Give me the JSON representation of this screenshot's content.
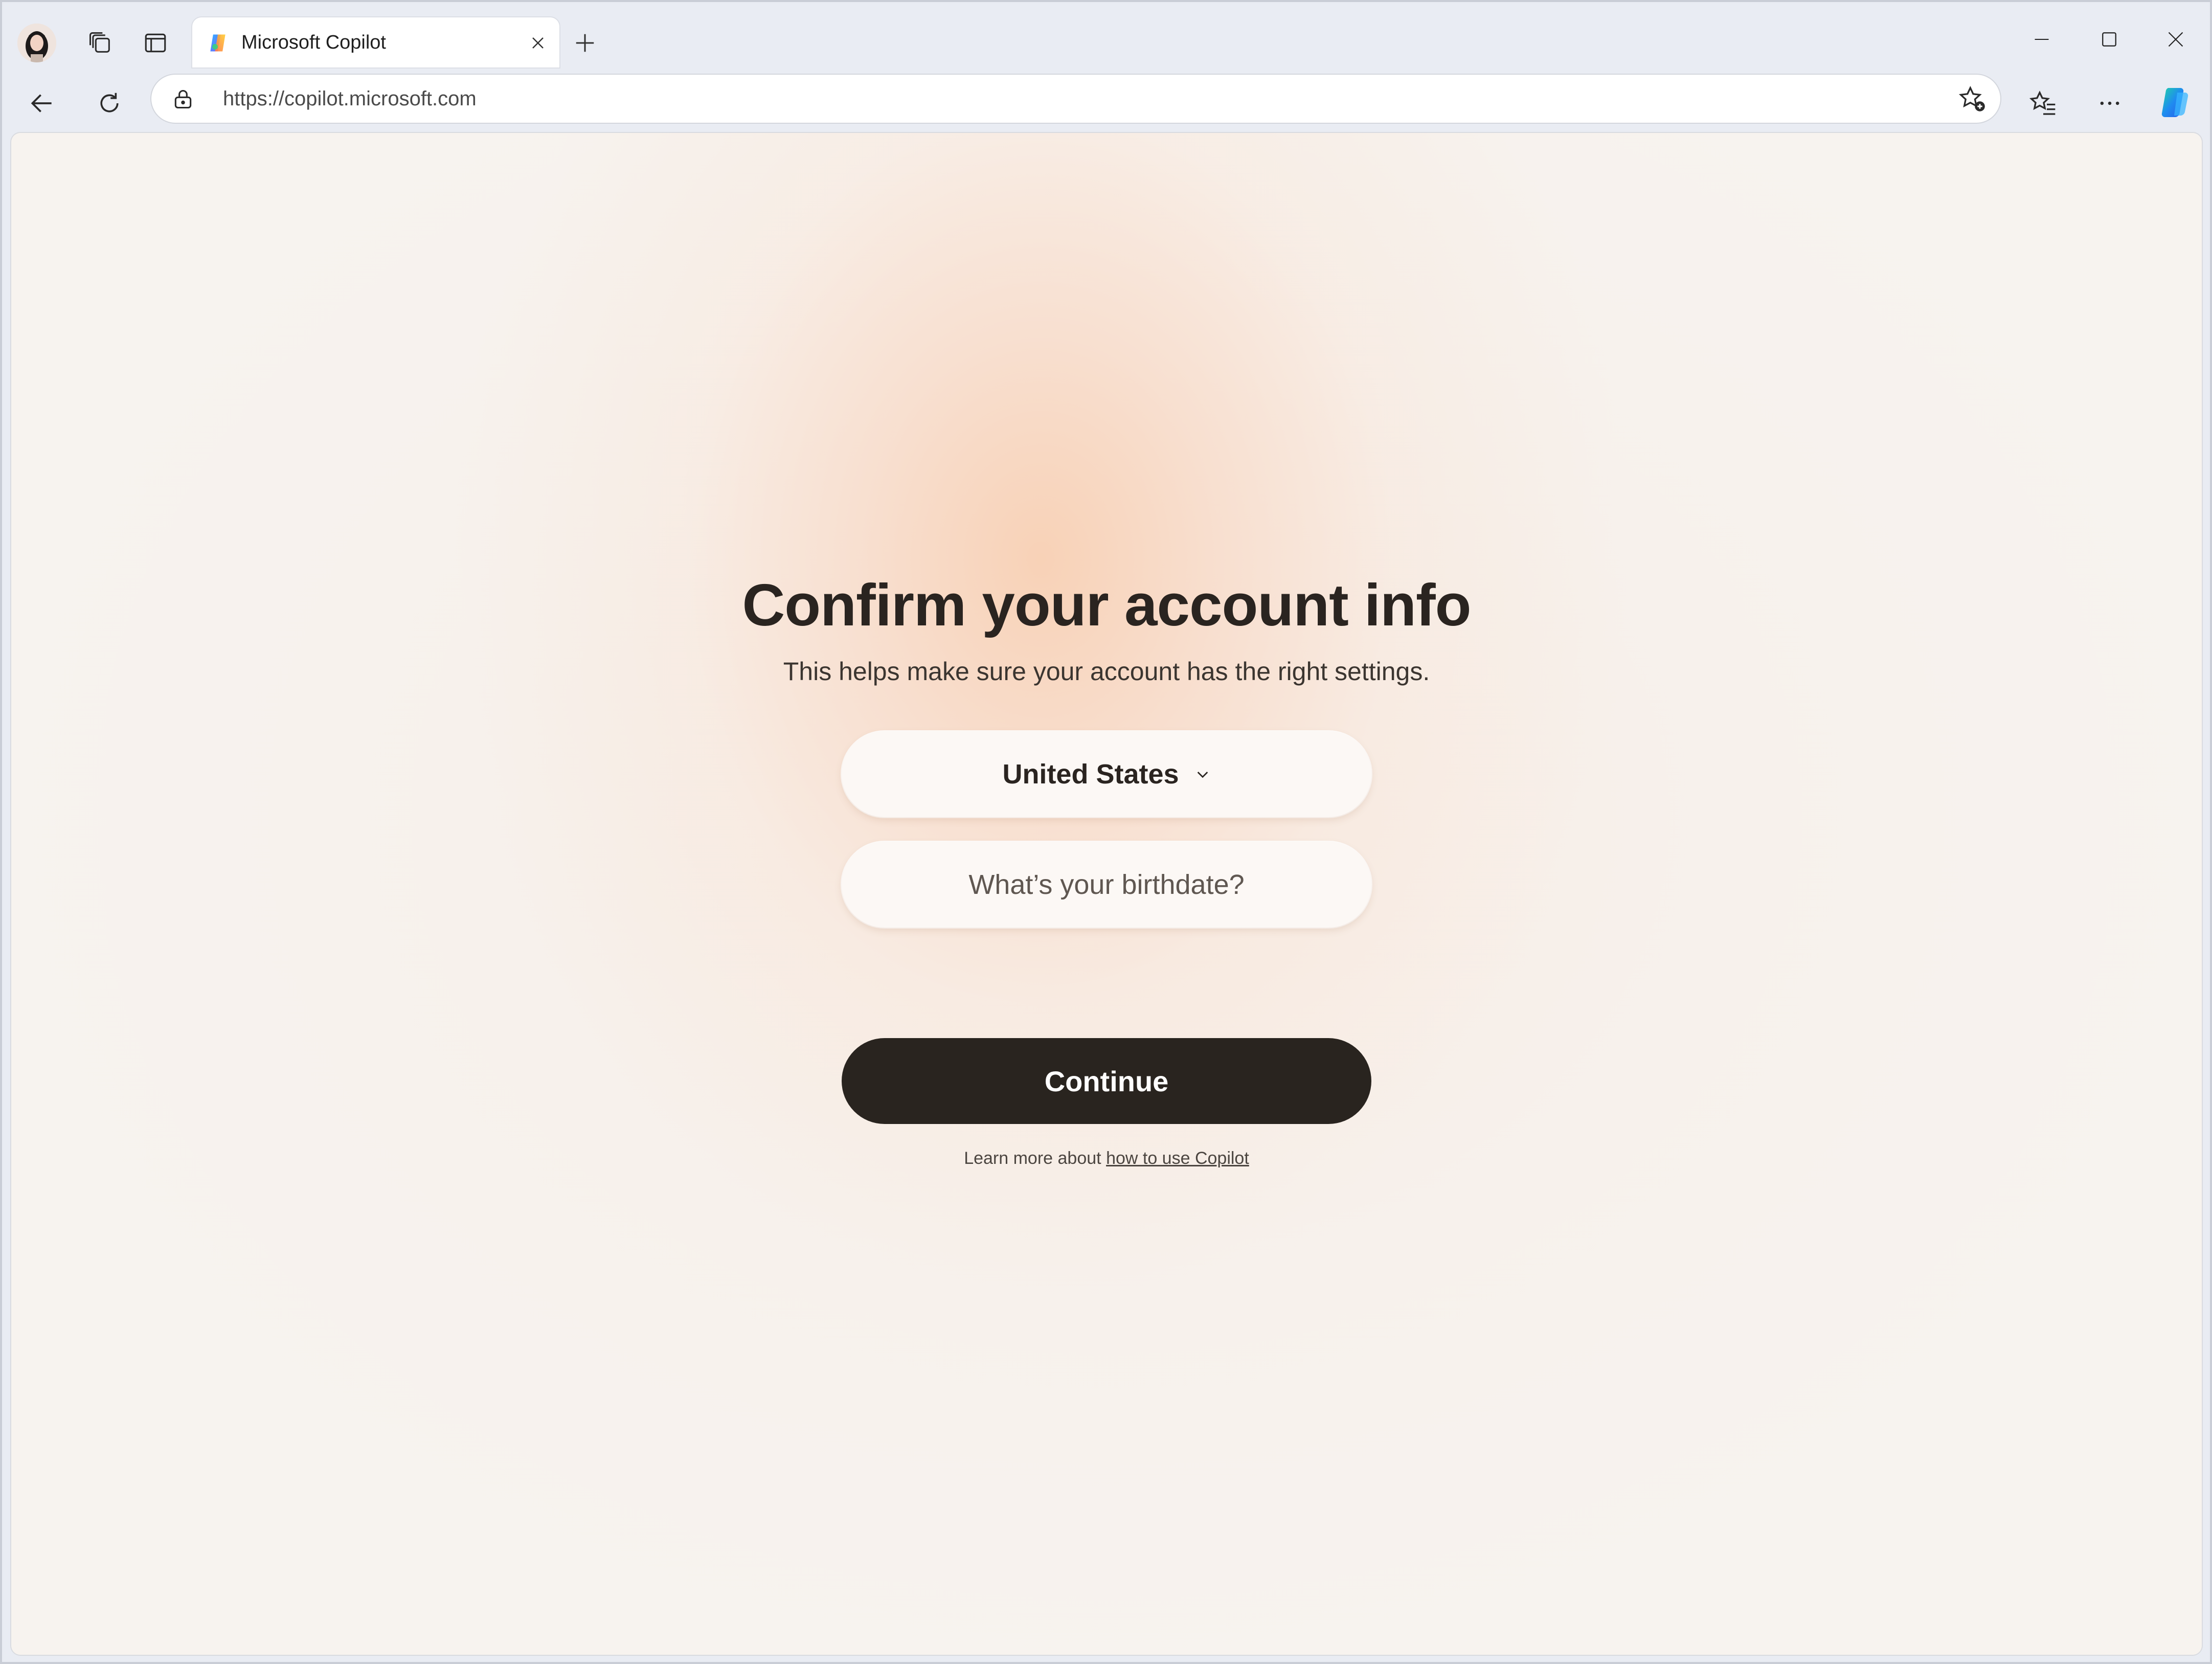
{
  "browser": {
    "tab": {
      "title": "Microsoft Copilot",
      "favicon": "copilot-logo-icon",
      "close_icon": "close-icon"
    },
    "new_tab_icon": "plus-icon",
    "profile_icon": "avatar",
    "workspaces_icon": "workspaces-icon",
    "vertical_tabs_icon": "vertical-tabs-icon",
    "window_controls": [
      "minimize-icon",
      "maximize-icon",
      "close-icon"
    ]
  },
  "toolbar": {
    "back_icon": "arrow-left-icon",
    "refresh_icon": "refresh-icon",
    "address": {
      "url": "https://copilot.microsoft.com",
      "site_info_icon": "site-info-icon",
      "add_favorite_icon": "star-add-icon"
    },
    "favorites_icon": "favorites-icon",
    "more_icon": "more-icon",
    "copilot_icon": "copilot-sidebar-icon"
  },
  "page": {
    "title": "Confirm your account info",
    "subtitle": "This helps make sure your account has the right settings.",
    "country": {
      "selected": "United States"
    },
    "birthdate": {
      "placeholder": "What’s your birthdate?",
      "value": ""
    },
    "continue_label": "Continue",
    "learn_more_prefix": "Learn more about",
    "learn_more_link": "how to use Copilot"
  },
  "colors": {
    "title_text": "#2a2420",
    "button_bg": "#29241f",
    "button_text": "#ffffff",
    "page_bg": "#f7f3ef",
    "glow": "#f8d0b4"
  }
}
